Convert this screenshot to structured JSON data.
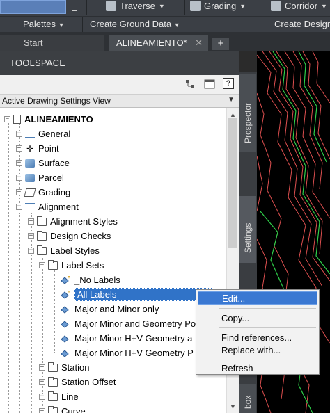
{
  "ribbon": {
    "row1": [
      {
        "label": "Traverse",
        "icon": "traverse-icon"
      },
      {
        "label": "Grading",
        "icon": "grading-icon"
      },
      {
        "label": "Corridor",
        "icon": "corridor-icon"
      }
    ],
    "row2": {
      "palettes": "Palettes",
      "create_ground_data": "Create Ground Data",
      "create_design": "Create Design"
    }
  },
  "tabs": {
    "start": "Start",
    "active": "ALINEAMIENTO*",
    "add": "+"
  },
  "toolspace": {
    "title": "TOOLSPACE",
    "help": "?",
    "view": "Active Drawing Settings View",
    "tree": {
      "root": "ALINEAMIENTO",
      "general": "General",
      "point": "Point",
      "surface": "Surface",
      "parcel": "Parcel",
      "grading": "Grading",
      "alignment": "Alignment",
      "alignment_styles": "Alignment Styles",
      "design_checks": "Design Checks",
      "label_styles": "Label Styles",
      "label_sets": "Label Sets",
      "no_labels": "_No Labels",
      "all_labels": "All Labels",
      "major_minor_only": "Major and Minor only",
      "major_minor_geometry": "Major Minor and Geometry Po",
      "major_minor_hv_a": "Major Minor H+V Geometry a",
      "major_minor_hv_p": "Major Minor H+V Geometry P",
      "station": "Station",
      "station_offset": "Station Offset",
      "line": "Line",
      "curve": "Curve"
    }
  },
  "side_tabs": {
    "prospector": "Prospector",
    "settings": "Settings",
    "toolbox": "box"
  },
  "context_menu": {
    "edit": "Edit...",
    "copy": "Copy...",
    "find_references": "Find references...",
    "replace_with": "Replace with...",
    "refresh": "Refresh"
  },
  "colors": {
    "selection": "#3073c8",
    "menu_highlight": "#3a78d2",
    "contour_red": "#e05050",
    "contour_green": "#2fd04a"
  }
}
